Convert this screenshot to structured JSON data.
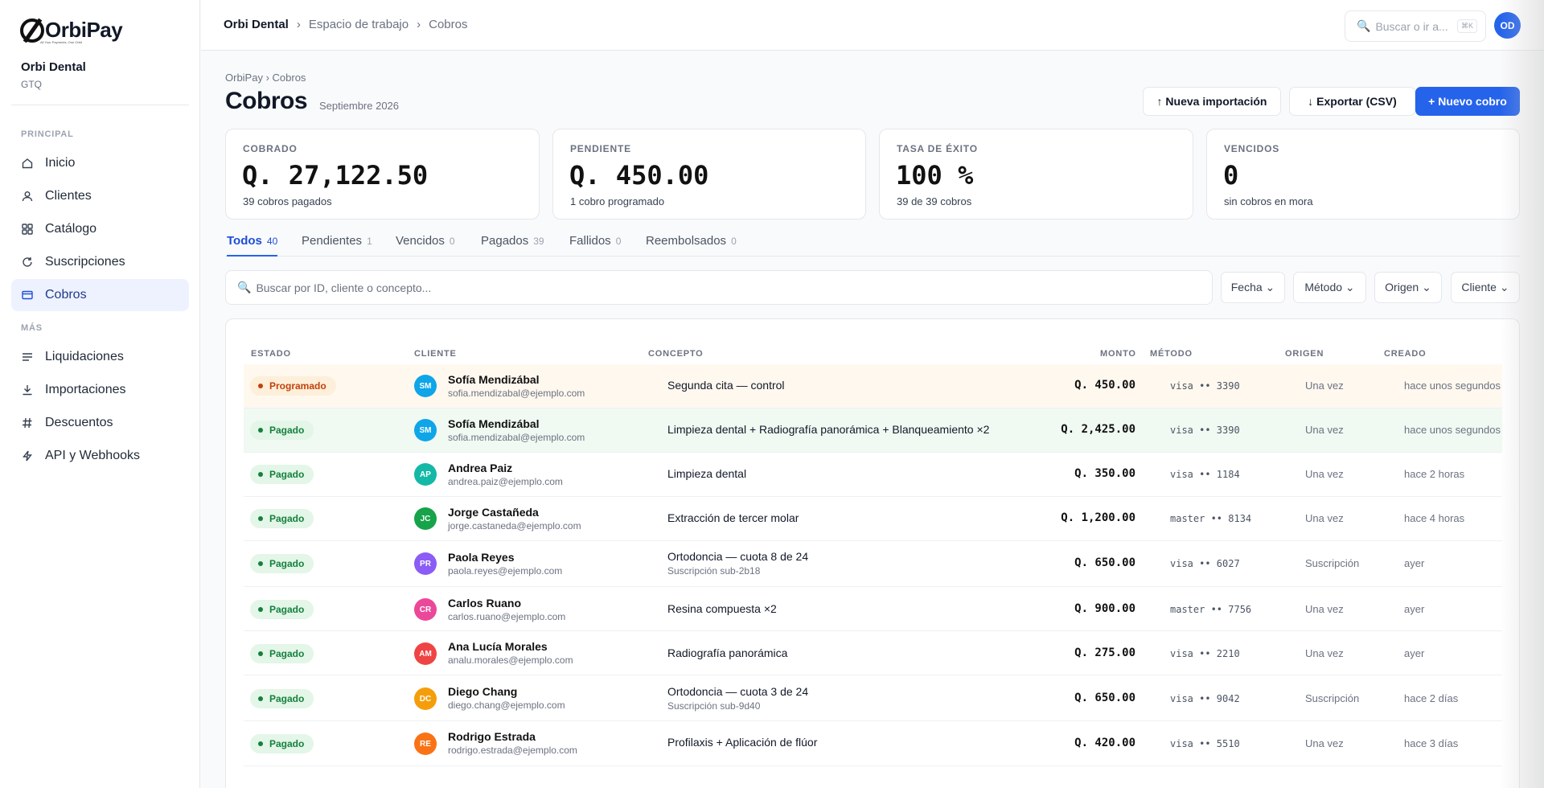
{
  "brand": {
    "name": "OrbiPay",
    "tagline": "All Your Payments, One Orbit"
  },
  "org": {
    "name": "Orbi Dental",
    "currency": "GTQ"
  },
  "sidebar": {
    "section_principal": "PRINCIPAL",
    "section_mas": "MÁS",
    "items": [
      {
        "label": "Inicio",
        "icon": "home-icon"
      },
      {
        "label": "Clientes",
        "icon": "user-icon"
      },
      {
        "label": "Catálogo",
        "icon": "grid-icon"
      },
      {
        "label": "Suscripciones",
        "icon": "refresh-icon"
      },
      {
        "label": "Cobros",
        "icon": "card-icon",
        "active": true
      },
      {
        "label": "Liquidaciones",
        "icon": "list-icon"
      },
      {
        "label": "Importaciones",
        "icon": "download-icon"
      },
      {
        "label": "Descuentos",
        "icon": "hash-icon"
      },
      {
        "label": "API y Webhooks",
        "icon": "bolt-icon"
      }
    ]
  },
  "topbar": {
    "breadcrumb": [
      "Orbi Dental",
      "Espacio de trabajo",
      "Cobros"
    ],
    "search_placeholder": "Buscar o ir a...",
    "search_shortcut": "⌘K",
    "user_initials": "OD"
  },
  "page": {
    "sub_breadcrumb": "OrbiPay › Cobros",
    "title": "Cobros",
    "period": "Septiembre 2026",
    "buttons": {
      "import": "↑ Nueva importación",
      "export": "↓ Exportar (CSV)",
      "new": "+ Nuevo cobro"
    }
  },
  "stats": [
    {
      "label": "COBRADO",
      "value": "Q. 27,122.50",
      "sub": "39 cobros pagados"
    },
    {
      "label": "PENDIENTE",
      "value": "Q. 450.00",
      "sub": "1 cobro programado"
    },
    {
      "label": "TASA DE ÉXITO",
      "value": "100 %",
      "sub": "39 de 39 cobros"
    },
    {
      "label": "VENCIDOS",
      "value": "0",
      "sub": "sin cobros en mora"
    }
  ],
  "tabs": [
    {
      "label": "Todos",
      "count": "40"
    },
    {
      "label": "Pendientes",
      "count": "1"
    },
    {
      "label": "Vencidos",
      "count": "0"
    },
    {
      "label": "Pagados",
      "count": "39"
    },
    {
      "label": "Fallidos",
      "count": "0"
    },
    {
      "label": "Reembolsados",
      "count": "0"
    }
  ],
  "filters": {
    "search_placeholder": "Buscar por ID, cliente o concepto...",
    "date": "Fecha ⌄",
    "method": "Método ⌄",
    "origin": "Origen ⌄",
    "client": "Cliente ⌄"
  },
  "table": {
    "headers": [
      "ESTADO",
      "CLIENTE",
      "CONCEPTO",
      "MONTO",
      "MÉTODO",
      "ORIGEN",
      "CREADO"
    ],
    "rows": [
      {
        "status": "Programado",
        "initials": "SM",
        "color": "#0ea5e9",
        "name": "Sofía Mendizábal",
        "email": "sofia.mendizabal@ejemplo.com",
        "concept": "Segunda cita — control",
        "concept_sub": "",
        "amount": "Q. 450.00",
        "method": "visa •• 3390",
        "origin": "Una vez",
        "created": "hace unos segundos"
      },
      {
        "status": "Pagado",
        "initials": "SM",
        "color": "#0ea5e9",
        "name": "Sofía Mendizábal",
        "email": "sofia.mendizabal@ejemplo.com",
        "concept": "Limpieza dental + Radiografía panorámica + Blanqueamiento ×2",
        "concept_sub": "",
        "amount": "Q. 2,425.00",
        "method": "visa •• 3390",
        "origin": "Una vez",
        "created": "hace unos segundos"
      },
      {
        "status": "Pagado",
        "initials": "AP",
        "color": "#14b8a6",
        "name": "Andrea Paiz",
        "email": "andrea.paiz@ejemplo.com",
        "concept": "Limpieza dental",
        "concept_sub": "",
        "amount": "Q. 350.00",
        "method": "visa •• 1184",
        "origin": "Una vez",
        "created": "hace 2 horas"
      },
      {
        "status": "Pagado",
        "initials": "JC",
        "color": "#16a34a",
        "name": "Jorge Castañeda",
        "email": "jorge.castaneda@ejemplo.com",
        "concept": "Extracción de tercer molar",
        "concept_sub": "",
        "amount": "Q. 1,200.00",
        "method": "master •• 8134",
        "origin": "Una vez",
        "created": "hace 4 horas"
      },
      {
        "status": "Pagado",
        "initials": "PR",
        "color": "#8b5cf6",
        "name": "Paola Reyes",
        "email": "paola.reyes@ejemplo.com",
        "concept": "Ortodoncia — cuota 8 de 24",
        "concept_sub": "Suscripción sub-2b18",
        "amount": "Q. 650.00",
        "method": "visa •• 6027",
        "origin": "Suscripción",
        "created": "ayer"
      },
      {
        "status": "Pagado",
        "initials": "CR",
        "color": "#ec4899",
        "name": "Carlos Ruano",
        "email": "carlos.ruano@ejemplo.com",
        "concept": "Resina compuesta ×2",
        "concept_sub": "",
        "amount": "Q. 900.00",
        "method": "master •• 7756",
        "origin": "Una vez",
        "created": "ayer"
      },
      {
        "status": "Pagado",
        "initials": "AM",
        "color": "#ef4444",
        "name": "Ana Lucía Morales",
        "email": "analu.morales@ejemplo.com",
        "concept": "Radiografía panorámica",
        "concept_sub": "",
        "amount": "Q. 275.00",
        "method": "visa •• 2210",
        "origin": "Una vez",
        "created": "ayer"
      },
      {
        "status": "Pagado",
        "initials": "DC",
        "color": "#f59e0b",
        "name": "Diego Chang",
        "email": "diego.chang@ejemplo.com",
        "concept": "Ortodoncia — cuota 3 de 24",
        "concept_sub": "Suscripción sub-9d40",
        "amount": "Q. 650.00",
        "method": "visa •• 9042",
        "origin": "Suscripción",
        "created": "hace 2 días"
      },
      {
        "status": "Pagado",
        "initials": "RE",
        "color": "#f97316",
        "name": "Rodrigo Estrada",
        "email": "rodrigo.estrada@ejemplo.com",
        "concept": "Profilaxis + Aplicación de flúor",
        "concept_sub": "",
        "amount": "Q. 420.00",
        "method": "visa •• 5510",
        "origin": "Una vez",
        "created": "hace 3 días"
      }
    ]
  }
}
